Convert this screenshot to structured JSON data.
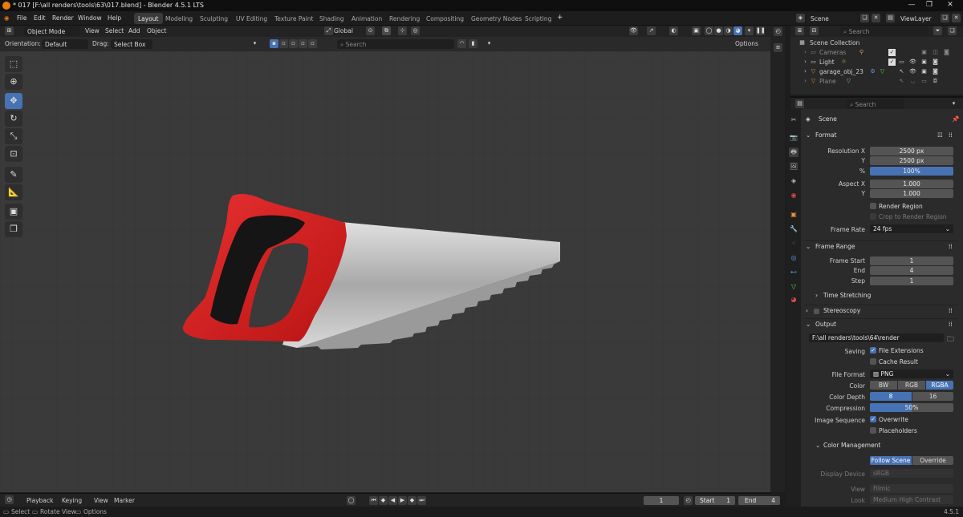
{
  "app": {
    "title": "* 017 [F:\\all renders\\tools\\63\\017.blend] - Blender 4.5.1 LTS",
    "version": "4.5.1"
  },
  "menu": [
    "File",
    "Edit",
    "Render",
    "Window",
    "Help"
  ],
  "workspaces": [
    "Layout",
    "Modeling",
    "Sculpting",
    "UV Editing",
    "Texture Paint",
    "Shading",
    "Animation",
    "Rendering",
    "Compositing",
    "Geometry Nodes",
    "Scripting"
  ],
  "active_workspace": "Layout",
  "scene": {
    "name": "Scene",
    "view_layer": "ViewLayer"
  },
  "viewport_header": {
    "mode": "Object Mode",
    "menus": [
      "View",
      "Select",
      "Add",
      "Object"
    ],
    "transform_orientation": "Global"
  },
  "tool_header": {
    "orientation_label": "Orientation:",
    "orientation_value": "Default",
    "drag_label": "Drag:",
    "drag_value": "Select Box",
    "search_placeholder": "Search",
    "options_label": "Options"
  },
  "outliner": {
    "search_placeholder": "Search",
    "collection": "Scene Collection",
    "items": [
      {
        "name": "Cameras"
      },
      {
        "name": "Light"
      },
      {
        "name": "garage_obj_23"
      },
      {
        "name": "Plane"
      }
    ]
  },
  "properties": {
    "search_placeholder": "Search",
    "context": "Scene",
    "format": {
      "title": "Format",
      "resolution_x_label": "Resolution X",
      "resolution_x": "2500 px",
      "y_label": "Y",
      "resolution_y": "2500 px",
      "pct_label": "%",
      "resolution_pct": "100%",
      "aspect_x_label": "Aspect X",
      "aspect_x": "1.000",
      "aspect_y_label": "Y",
      "aspect_y": "1.000",
      "render_region": "Render Region",
      "crop_region": "Crop to Render Region",
      "frame_rate_label": "Frame Rate",
      "frame_rate": "24 fps"
    },
    "frame_range": {
      "title": "Frame Range",
      "start_label": "Frame Start",
      "start": "1",
      "end_label": "End",
      "end": "4",
      "step_label": "Step",
      "step": "1",
      "time_stretching": "Time Stretching"
    },
    "stereoscopy": "Stereoscopy",
    "output": {
      "title": "Output",
      "path": "F:\\all renders\\tools\\64\\render",
      "saving_label": "Saving",
      "file_extensions": "File Extensions",
      "cache_result": "Cache Result",
      "file_format_label": "File Format",
      "file_format": "PNG",
      "color_label": "Color",
      "color_modes": [
        "BW",
        "RGB",
        "RGBA"
      ],
      "color_depth_label": "Color Depth",
      "color_depths": [
        "8",
        "16"
      ],
      "compression_label": "Compression",
      "compression": "50%",
      "image_sequence_label": "Image Sequence",
      "overwrite": "Overwrite",
      "placeholders": "Placeholders"
    },
    "color_management": {
      "title": "Color Management",
      "follow_scene": "Follow Scene",
      "override": "Override",
      "display_device_label": "Display Device",
      "display_device": "sRGB",
      "view_label": "View",
      "view": "Filmic",
      "look_label": "Look",
      "look": "Medium High Contrast"
    }
  },
  "timeline": {
    "menus": [
      "Playback",
      "Keying",
      "View",
      "Marker"
    ],
    "current_frame": "1",
    "start_label": "Start",
    "start": "1",
    "end_label": "End",
    "end": "4"
  },
  "statusbar": {
    "items": [
      "Select",
      "Rotate View",
      "Options"
    ]
  },
  "colors": {
    "accent": "#4772b3",
    "handle_red": "#d41e1e",
    "grip_black": "#151515",
    "blade": "#b8b8b8"
  }
}
